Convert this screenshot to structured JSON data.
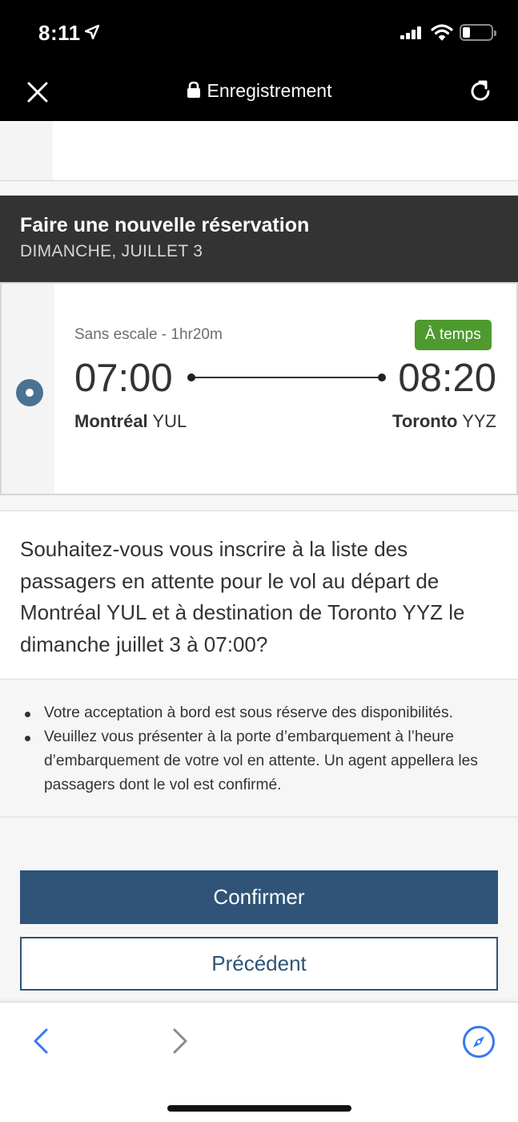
{
  "status_bar": {
    "time": "8:11"
  },
  "nav": {
    "title": "Enregistrement",
    "icons": {
      "close": "close-icon",
      "lock": "lock-icon",
      "reload": "reload-icon"
    }
  },
  "reservation": {
    "title": "Faire une nouvelle réservation",
    "date": "DIMANCHE, JUILLET 3"
  },
  "flight": {
    "info": "Sans escale - 1hr20m",
    "status": "À temps",
    "departure_time": "07:00",
    "arrival_time": "08:20",
    "departure_city": "Montréal",
    "departure_code": "YUL",
    "arrival_city": "Toronto",
    "arrival_code": "YYZ",
    "selected": true
  },
  "question": "Souhaitez-vous vous inscrire à la liste des passagers en attente pour le vol au départ de Montréal YUL et à destination de Toronto YYZ le dimanche juillet 3 à 07:00?",
  "notes": [
    "Votre acceptation à bord est sous réserve des disponibilités.",
    "Veuillez vous présenter à la porte d’embarquement à l’heure d’embarquement de votre vol en attente. Un agent appellera les passagers dont le vol est confirmé."
  ],
  "buttons": {
    "confirm": "Confirmer",
    "previous": "Précédent"
  },
  "colors": {
    "primary": "#2f5478",
    "status_green": "#4e9a2e",
    "header_dark": "#333333",
    "ios_blue": "#3478f6"
  },
  "bottom_bar": {
    "icons": [
      "back-icon",
      "forward-icon",
      "safari-icon"
    ]
  }
}
